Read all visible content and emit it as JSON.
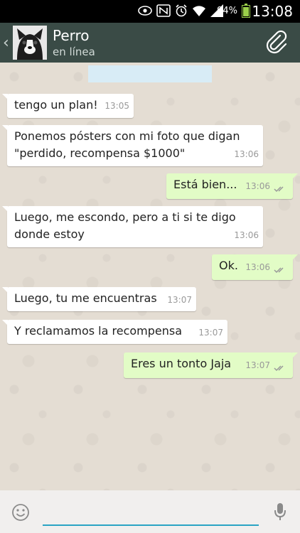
{
  "status_bar": {
    "battery_percent": "94%",
    "battery_level": 0.94,
    "time": "13:08",
    "battery_color": "#9bd04a"
  },
  "header": {
    "back_icon": "chevron-left-icon",
    "contact_name": "Perro",
    "contact_status": "en línea",
    "attach_icon": "paperclip-icon",
    "background_color": "#3a4b46"
  },
  "messages": [
    {
      "direction": "in",
      "text": "tengo un plan!",
      "time": "13:05"
    },
    {
      "direction": "in",
      "text": "Ponemos pósters con mi foto que digan \"perdido, recompensa $1000\"",
      "time": "13:06"
    },
    {
      "direction": "out",
      "text": "Está bien...",
      "time": "13:06"
    },
    {
      "direction": "in",
      "text": "Luego, me escondo, pero a ti si te digo donde estoy",
      "time": "13:06"
    },
    {
      "direction": "out",
      "text": "Ok.",
      "time": "13:06"
    },
    {
      "direction": "in",
      "text": "Luego, tu me encuentras",
      "time": "13:07"
    },
    {
      "direction": "in",
      "text": "Y reclamamos la recompensa",
      "time": "13:07"
    },
    {
      "direction": "out",
      "text": "Eres un tonto Jaja",
      "time": "13:07"
    }
  ],
  "input_bar": {
    "emoji_icon": "smiley-icon",
    "mic_icon": "microphone-icon",
    "text_value": "",
    "accent_color": "#2aa3c3"
  }
}
